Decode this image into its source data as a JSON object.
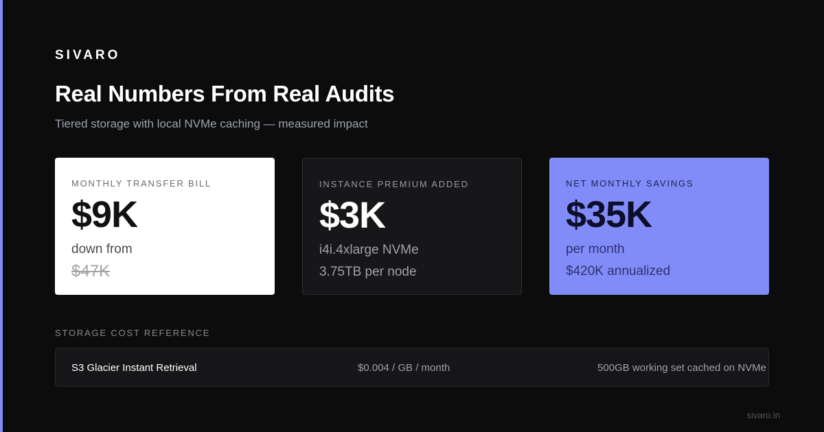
{
  "brand": "SIVARO",
  "title": "Real Numbers From Real Audits",
  "subtitle": "Tiered storage with local NVMe caching — measured impact",
  "colors": {
    "accent": "#818cf8",
    "background": "#0c0c0c"
  },
  "cards": [
    {
      "label": "MONTHLY TRANSFER BILL",
      "value": "$9K",
      "line1": "down from",
      "line2": "$47K"
    },
    {
      "label": "INSTANCE PREMIUM ADDED",
      "value": "$3K",
      "line1": "i4i.4xlarge NVMe",
      "line2": "3.75TB per node"
    },
    {
      "label": "NET MONTHLY SAVINGS",
      "value": "$35K",
      "line1": "per month",
      "line2": "$420K annualized"
    }
  ],
  "reference": {
    "heading": "STORAGE COST REFERENCE",
    "name": "S3 Glacier Instant Retrieval",
    "price": "$0.004 / GB / month",
    "note": "500GB working set cached on NVMe"
  },
  "footer": {
    "url": "sivaro.in"
  }
}
